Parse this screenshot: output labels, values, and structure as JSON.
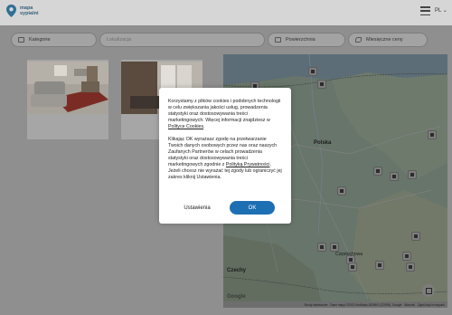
{
  "header": {
    "logo_line1": "mapa",
    "logo_line2": "sypialni",
    "language": "PL"
  },
  "filters": {
    "category": "Kategorie",
    "location_placeholder": "Lokalizacja",
    "area": "Powierzchnia",
    "price": "Miesięczne ceny"
  },
  "map": {
    "country_label": "Polska",
    "czech_label": "Czechy",
    "city_label": "Częstochowa",
    "google": "Google",
    "shortcuts": "Skróty klawiszowe",
    "copyright": "Dane mapy ©2023 GeoBasis-DE/BKG (©2009), Google",
    "terms": "Warunki",
    "report": "Zgłoś błąd w mapach"
  },
  "cookie_dialog": {
    "p1_a": "Korzystamy z plików cookies i podobnych technologii w celu zwiększania jakości usług, prowadzenia statystyki oraz dostosowywania treści marketingowych. Więcej informacji znajdziesz w ",
    "p1_link": "Polityce Cookies",
    "p1_end": ".",
    "p2_a": "Klikając OK wyrażasz zgodę na przetwarzanie Twoich danych osobowych przez nas oraz naszych Zaufanych Partnerów w celach prowadzenia statystyki oraz dostosowywania treści marketingowych zgodnie z ",
    "p2_link": "Polityką Prywatności",
    "p2_b": ". Jeżeli chcesz nie wyrażać tej zgody lub ograniczyć jej zakres kliknij Ustawienia.",
    "settings_button": "Ustawienia",
    "ok_button": "OK"
  }
}
